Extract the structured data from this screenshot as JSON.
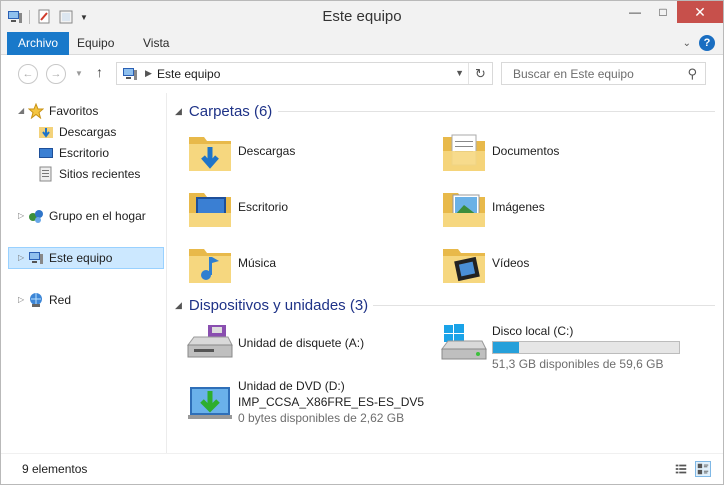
{
  "window": {
    "title": "Este equipo",
    "minimize": "—",
    "maximize": "□",
    "close": "✕"
  },
  "ribbon": {
    "tabs": [
      "Archivo",
      "Equipo",
      "Vista"
    ]
  },
  "address": {
    "location": "Este equipo",
    "search_placeholder": "Buscar en Este equipo"
  },
  "nav_pane": {
    "favorites": "Favoritos",
    "downloads": "Descargas",
    "desktop": "Escritorio",
    "recent": "Sitios recientes",
    "homegroup": "Grupo en el hogar",
    "this_pc": "Este equipo",
    "network": "Red"
  },
  "content": {
    "folders_header": "Carpetas (6)",
    "folders": [
      "Descargas",
      "Documentos",
      "Escritorio",
      "Imágenes",
      "Música",
      "Vídeos"
    ],
    "devices_header": "Dispositivos y unidades (3)",
    "floppy": "Unidad de disquete (A:)",
    "local_disk": {
      "name": "Disco local (C:)",
      "space": "51,3 GB disponibles de 59,6 GB",
      "used_fraction": 0.14
    },
    "dvd": {
      "name": "Unidad de DVD (D:)",
      "label": "IMP_CCSA_X86FRE_ES-ES_DV5",
      "space": "0 bytes disponibles de 2,62 GB"
    }
  },
  "status": {
    "count": "9 elementos"
  },
  "colors": {
    "accent": "#1979ca",
    "selection": "#cce8ff",
    "group_header": "#1e3287",
    "close_button": "#c7504b",
    "folder": "#f3d27a",
    "drive_fill": "#26a0da"
  }
}
